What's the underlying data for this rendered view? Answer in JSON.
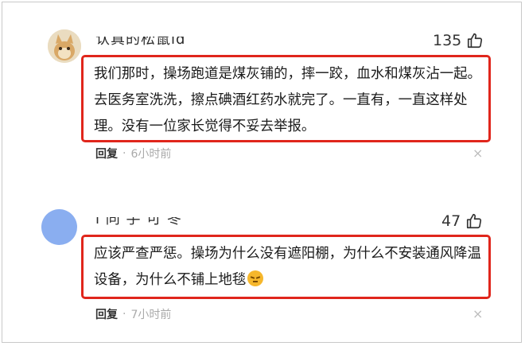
{
  "comments": [
    {
      "username": "认真的松鼠ld",
      "likes": "135",
      "body": "我们那时，操场跑道是煤灰铺的，摔一跤，血水和煤灰沾一起。去医务室洗洗，擦点碘酒红药水就完了。一直有，一直这样处理。没有一位家长觉得不妥去举报。",
      "reply_label": "回复",
      "dot": "·",
      "time": "6小时前",
      "close_icon": "×"
    },
    {
      "username": "i 同 手 可 冬",
      "likes": "47",
      "body": "应该严查严惩。操场为什么没有遮阳棚，为什么不安装通风降温设备，为什么不铺上地毯",
      "emoji": "angry-face",
      "reply_label": "回复",
      "dot": "·",
      "time": "7小时前",
      "close_icon": "×"
    }
  ],
  "colors": {
    "highlight_border": "#e0261c",
    "muted_text": "#aaaaaa",
    "avatar_2": "#8aaef0"
  }
}
